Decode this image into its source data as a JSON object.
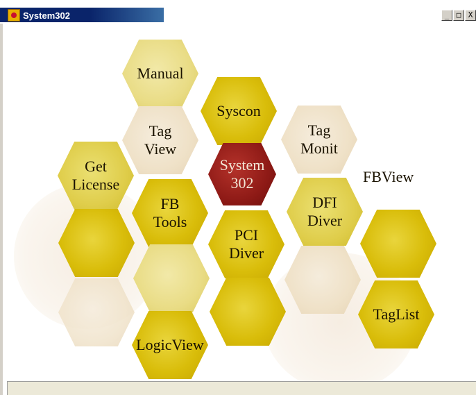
{
  "window": {
    "title": "System302",
    "minimize_glyph": "_",
    "maximize_glyph": "□",
    "close_glyph": "X"
  },
  "hexes": {
    "manual": "Manual",
    "syscon": "Syscon",
    "tag_view": "Tag\nView",
    "tag_monit": "Tag\nMonit",
    "system302": "System\n302",
    "get_license": "Get\nLicense",
    "fbview": "FBView",
    "fb_tools": "FB\nTools",
    "dfi_diver": "DFI\nDiver",
    "pci_diver": "PCI\nDiver",
    "taglist": "TagList",
    "logicview": "LogicView"
  },
  "status": {
    "text": ""
  }
}
